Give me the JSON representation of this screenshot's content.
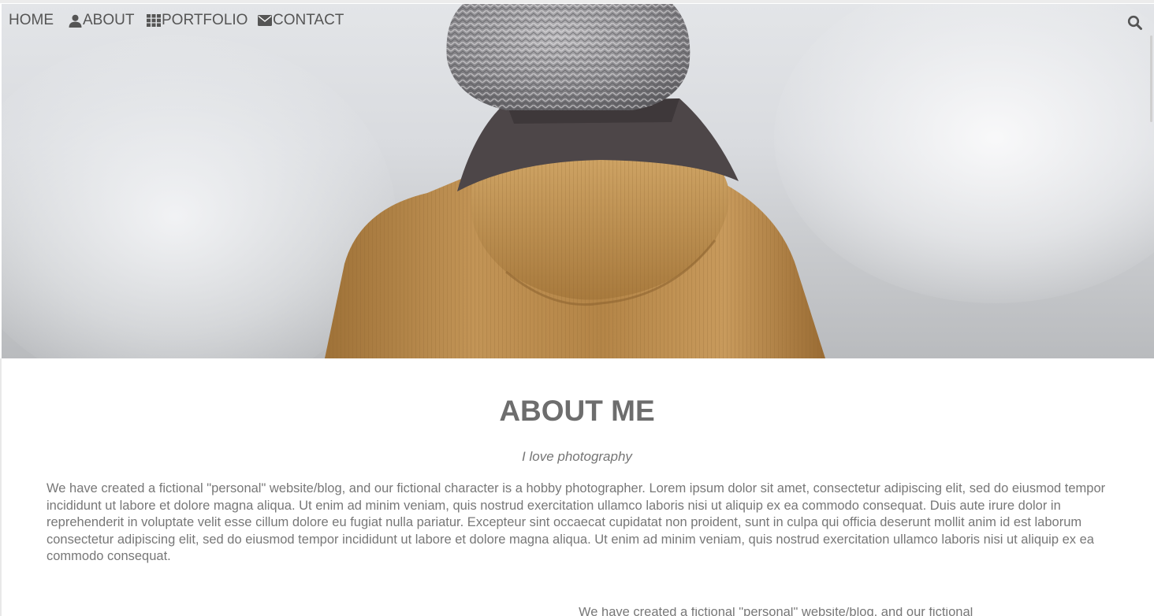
{
  "nav": {
    "home_label": "HOME",
    "about_label": "ABOUT",
    "portfolio_label": "PORTFOLIO",
    "contact_label": "CONTACT",
    "about_icon": "user-icon",
    "portfolio_icon": "grid-icon",
    "contact_icon": "envelope-icon",
    "search_icon": "search-icon"
  },
  "hero": {
    "image": "person-in-knit-hat-and-mustard-corduroy-jacket-from-behind"
  },
  "about": {
    "title": "ABOUT ME",
    "tagline": "I love photography",
    "body": "We have created a fictional \"personal\" website/blog, and our fictional character is a hobby photographer. Lorem ipsum dolor sit amet, consectetur adipiscing elit, sed do eiusmod tempor incididunt ut labore et dolore magna aliqua. Ut enim ad minim veniam, quis nostrud exercitation ullamco laboris nisi ut aliquip ex ea commodo consequat. Duis aute irure dolor in reprehenderit in voluptate velit esse cillum dolore eu fugiat nulla pariatur. Excepteur sint occaecat cupidatat non proident, sunt in culpa qui officia deserunt mollit anim id est laborum consectetur adipiscing elit, sed do eiusmod tempor incididunt ut labore et dolore magna aliqua. Ut enim ad minim veniam, quis nostrud exercitation ullamco laboris nisi ut aliquip ex ea commodo consequat.",
    "next_paragraph_partial": "We have created a fictional \"personal\" website/blog, and our fictional"
  },
  "colors": {
    "text": "#757575",
    "nav_text": "#555555",
    "jacket": "#b8894a",
    "hat": "#8a8a8e",
    "scarf": "#4a4446"
  }
}
